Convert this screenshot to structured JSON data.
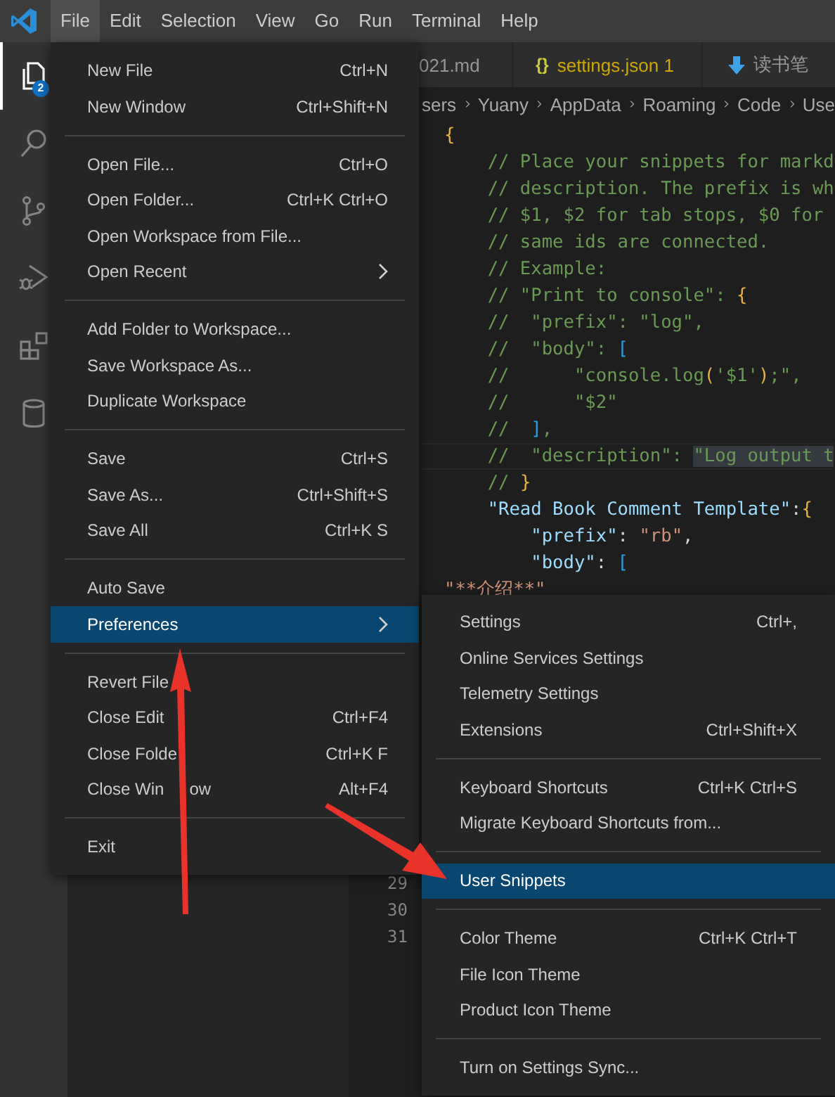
{
  "menu_bar": [
    {
      "label": "File",
      "selected": true
    },
    {
      "label": "Edit",
      "selected": false
    },
    {
      "label": "Selection",
      "selected": false
    },
    {
      "label": "View",
      "selected": false
    },
    {
      "label": "Go",
      "selected": false
    },
    {
      "label": "Run",
      "selected": false
    },
    {
      "label": "Terminal",
      "selected": false
    },
    {
      "label": "Help",
      "selected": false
    }
  ],
  "activity_bar": {
    "badge": "2",
    "items": [
      {
        "kind": "explorer",
        "selected": true
      },
      {
        "kind": "search",
        "selected": false
      },
      {
        "kind": "scm",
        "selected": false
      },
      {
        "kind": "debug",
        "selected": false
      },
      {
        "kind": "extensions",
        "selected": false
      },
      {
        "kind": "database",
        "selected": false
      }
    ]
  },
  "tabs": [
    {
      "kind": "plain",
      "label": "021.md",
      "warning": false
    },
    {
      "kind": "json",
      "icon": "{}",
      "label": "settings.json 1",
      "warning": true
    },
    {
      "kind": "download",
      "label": "读书笔",
      "warning": false
    }
  ],
  "breadcrumb": [
    "sers",
    "Yuany",
    "AppData",
    "Roaming",
    "Code",
    "Use"
  ],
  "code_lines": [
    {
      "current": false,
      "tokens": [
        {
          "kind": "bracket1",
          "text": "{"
        }
      ]
    },
    {
      "current": false,
      "tokens": [
        {
          "kind": "comment",
          "text": "    // Place your snippets for markd"
        }
      ]
    },
    {
      "current": false,
      "tokens": [
        {
          "kind": "comment",
          "text": "    // description. The prefix is wh"
        }
      ]
    },
    {
      "current": false,
      "tokens": [
        {
          "kind": "comment",
          "text": "    // $1, $2 for tab stops, $0 for"
        }
      ]
    },
    {
      "current": false,
      "tokens": [
        {
          "kind": "comment",
          "text": "    // same ids are connected."
        }
      ]
    },
    {
      "current": false,
      "tokens": [
        {
          "kind": "comment",
          "text": "    // Example:"
        }
      ]
    },
    {
      "current": false,
      "tokens": [
        {
          "kind": "comment",
          "text": "    // \"Print to console\": "
        },
        {
          "kind": "bracket1",
          "text": "{"
        }
      ]
    },
    {
      "current": false,
      "tokens": [
        {
          "kind": "comment",
          "text": "    //  \"prefix\": \"log\","
        }
      ]
    },
    {
      "current": false,
      "tokens": [
        {
          "kind": "comment",
          "text": "    //  \"body\": "
        },
        {
          "kind": "bracket2",
          "text": "["
        }
      ]
    },
    {
      "current": false,
      "tokens": [
        {
          "kind": "comment",
          "text": "    //      \"console.log"
        },
        {
          "kind": "bracket1",
          "text": "("
        },
        {
          "kind": "comment",
          "text": "'$1'"
        },
        {
          "kind": "bracket1",
          "text": ")"
        },
        {
          "kind": "comment",
          "text": ";\","
        }
      ]
    },
    {
      "current": false,
      "tokens": [
        {
          "kind": "comment",
          "text": "    //      \"$2\""
        }
      ]
    },
    {
      "current": false,
      "tokens": [
        {
          "kind": "comment",
          "text": "    //  "
        },
        {
          "kind": "bracket2",
          "text": "]"
        },
        {
          "kind": "comment",
          "text": ","
        }
      ]
    },
    {
      "current": true,
      "tokens": [
        {
          "kind": "comment",
          "text": "    //  \"description\": "
        },
        {
          "kind": "match",
          "text": "\"Log output t"
        }
      ]
    },
    {
      "current": false,
      "tokens": [
        {
          "kind": "comment",
          "text": "    // "
        },
        {
          "kind": "bracket1",
          "text": "}"
        }
      ]
    },
    {
      "current": false,
      "tokens": [
        {
          "kind": "key",
          "text": "    \"Read Book Comment Template\""
        },
        {
          "kind": "punct",
          "text": ":"
        },
        {
          "kind": "bracket1",
          "text": "{"
        }
      ]
    },
    {
      "current": false,
      "tokens": [
        {
          "kind": "key",
          "text": "        \"prefix\""
        },
        {
          "kind": "punct",
          "text": ": "
        },
        {
          "kind": "string",
          "text": "\"rb\""
        },
        {
          "kind": "punct",
          "text": ","
        }
      ]
    },
    {
      "current": false,
      "tokens": [
        {
          "kind": "key",
          "text": "        \"body\""
        },
        {
          "kind": "punct",
          "text": ": "
        },
        {
          "kind": "bracket2",
          "text": "["
        }
      ]
    },
    {
      "current": false,
      "tokens": [
        {
          "kind": "string",
          "text": "\"**介绍**\""
        }
      ]
    }
  ],
  "line_numbers": [
    "29",
    "30",
    "31"
  ],
  "file_menu": [
    [
      {
        "label": "New File",
        "shortcut": "Ctrl+N",
        "selected": false,
        "submenu": false
      },
      {
        "label": "New Window",
        "shortcut": "Ctrl+Shift+N",
        "selected": false,
        "submenu": false
      }
    ],
    [
      {
        "label": "Open File...",
        "shortcut": "Ctrl+O",
        "selected": false,
        "submenu": false
      },
      {
        "label": "Open Folder...",
        "shortcut": "Ctrl+K Ctrl+O",
        "selected": false,
        "submenu": false
      },
      {
        "label": "Open Workspace from File...",
        "selected": false,
        "submenu": false
      },
      {
        "label": "Open Recent",
        "selected": false,
        "submenu": true
      }
    ],
    [
      {
        "label": "Add Folder to Workspace...",
        "selected": false,
        "submenu": false
      },
      {
        "label": "Save Workspace As...",
        "selected": false,
        "submenu": false
      },
      {
        "label": "Duplicate Workspace",
        "selected": false,
        "submenu": false
      }
    ],
    [
      {
        "label": "Save",
        "shortcut": "Ctrl+S",
        "selected": false,
        "submenu": false
      },
      {
        "label": "Save As...",
        "shortcut": "Ctrl+Shift+S",
        "selected": false,
        "submenu": false
      },
      {
        "label": "Save All",
        "shortcut": "Ctrl+K S",
        "selected": false,
        "submenu": false
      }
    ],
    [
      {
        "label": "Auto Save",
        "selected": false,
        "submenu": false
      },
      {
        "label": "Preferences",
        "selected": true,
        "submenu": true
      }
    ],
    [
      {
        "label": "Revert File",
        "selected": false,
        "submenu": false
      },
      {
        "label": "Close Edit",
        "shortcut": "Ctrl+F4",
        "selected": false,
        "submenu": false
      },
      {
        "label": "Close Folde",
        "shortcut": "Ctrl+K F",
        "selected": false,
        "submenu": false
      },
      {
        "label": "Close Win",
        "tail": "ow",
        "shortcut": "Alt+F4",
        "selected": false,
        "submenu": false
      }
    ],
    [
      {
        "label": "Exit",
        "selected": false,
        "submenu": false
      }
    ]
  ],
  "preferences_menu": [
    [
      {
        "label": "Settings",
        "shortcut": "Ctrl+,",
        "selected": false
      },
      {
        "label": "Online Services Settings",
        "selected": false
      },
      {
        "label": "Telemetry Settings",
        "selected": false
      },
      {
        "label": "Extensions",
        "shortcut": "Ctrl+Shift+X",
        "selected": false
      }
    ],
    [
      {
        "label": "Keyboard Shortcuts",
        "shortcut": "Ctrl+K Ctrl+S",
        "selected": false
      },
      {
        "label": "Migrate Keyboard Shortcuts from...",
        "selected": false
      }
    ],
    [
      {
        "label": "User Snippets",
        "selected": true
      }
    ],
    [
      {
        "label": "Color Theme",
        "shortcut": "Ctrl+K Ctrl+T",
        "selected": false
      },
      {
        "label": "File Icon Theme",
        "selected": false
      },
      {
        "label": "Product Icon Theme",
        "selected": false
      }
    ],
    [
      {
        "label": "Turn on Settings Sync...",
        "selected": false
      }
    ]
  ]
}
